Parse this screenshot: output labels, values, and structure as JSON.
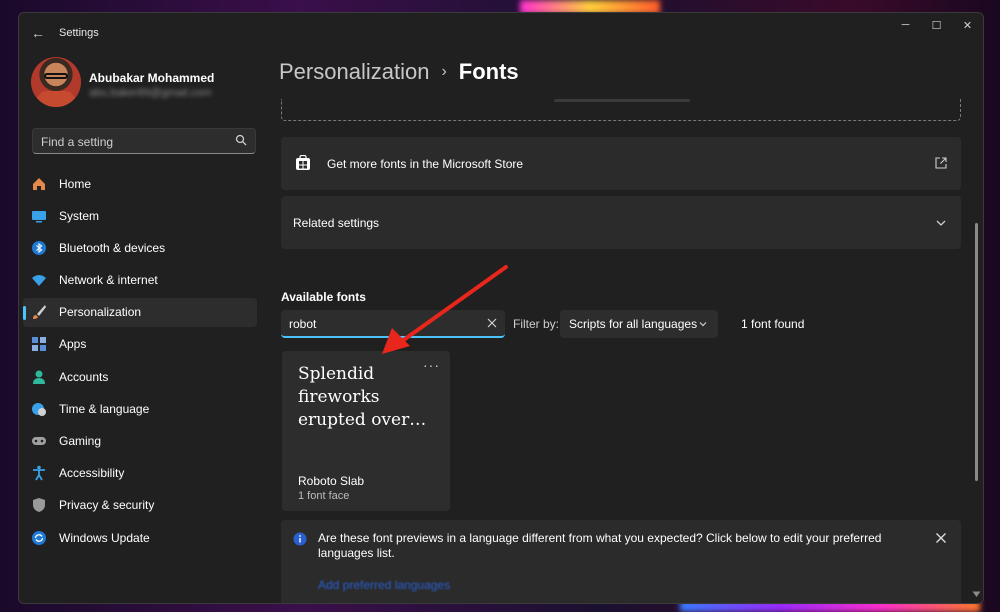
{
  "window": {
    "title": "Settings"
  },
  "profile": {
    "name": "Abubakar Mohammed",
    "email": "abu.baker89@gmail.com"
  },
  "search": {
    "placeholder": "Find a setting"
  },
  "sidebar": {
    "items": [
      {
        "label": "Home",
        "icon": "home-icon",
        "active": false
      },
      {
        "label": "System",
        "icon": "system-icon",
        "active": false
      },
      {
        "label": "Bluetooth & devices",
        "icon": "bluetooth-icon",
        "active": false
      },
      {
        "label": "Network & internet",
        "icon": "network-icon",
        "active": false
      },
      {
        "label": "Personalization",
        "icon": "brush-icon",
        "active": true
      },
      {
        "label": "Apps",
        "icon": "apps-icon",
        "active": false
      },
      {
        "label": "Accounts",
        "icon": "accounts-icon",
        "active": false
      },
      {
        "label": "Time & language",
        "icon": "globe-clock-icon",
        "active": false
      },
      {
        "label": "Gaming",
        "icon": "gamepad-icon",
        "active": false
      },
      {
        "label": "Accessibility",
        "icon": "accessibility-icon",
        "active": false
      },
      {
        "label": "Privacy & security",
        "icon": "shield-icon",
        "active": false
      },
      {
        "label": "Windows Update",
        "icon": "update-icon",
        "active": false
      }
    ]
  },
  "header": {
    "parent": "Personalization",
    "separator": "›",
    "current": "Fonts"
  },
  "main": {
    "store_card_label": "Get more fonts in the Microsoft Store",
    "related_label": "Related settings",
    "available_title": "Available fonts",
    "font_search_value": "robot",
    "filter_label": "Filter by:",
    "filter_value": "Scripts for all languages",
    "found_count": "1 font found",
    "font_tile": {
      "preview": "Splendid fireworks erupted over…",
      "name": "Roboto Slab",
      "faces": "1 font face"
    },
    "info": {
      "text": "Are these font previews in a language different from what you expected? Click below to edit your preferred languages list.",
      "link": "Add preferred languages"
    }
  },
  "colors": {
    "accent": "#4cc2ff",
    "annotation_arrow": "#e8261c"
  }
}
